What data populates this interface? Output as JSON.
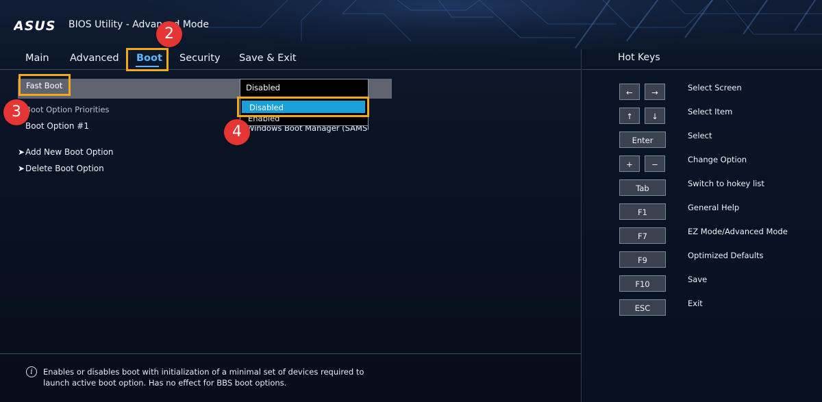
{
  "header": {
    "brand": "ASUS",
    "title": "BIOS Utility - Advanced Mode"
  },
  "tabs": [
    {
      "label": "Main"
    },
    {
      "label": "Advanced"
    },
    {
      "label": "Boot",
      "active": true
    },
    {
      "label": "Security"
    },
    {
      "label": "Save & Exit"
    }
  ],
  "settings": {
    "fast_boot": {
      "label": "Fast Boot",
      "value": "Disabled"
    },
    "priorities_label": "Boot Option Priorities",
    "boot_option_1": {
      "label": "Boot Option #1",
      "value": "Windows Boot Manager (SAMSUNG"
    },
    "add_boot": "Add New Boot Option",
    "delete_boot": "Delete Boot Option"
  },
  "dropdown": {
    "options": [
      "Disabled",
      "Enabled"
    ],
    "highlighted_index": 0
  },
  "annotations": [
    "2",
    "3",
    "4"
  ],
  "hotkeys": {
    "title": "Hot Keys",
    "items": [
      {
        "keys": [
          "←",
          "→"
        ],
        "desc": "Select Screen"
      },
      {
        "keys": [
          "↑",
          "↓"
        ],
        "desc": "Select Item"
      },
      {
        "keys": [
          "Enter"
        ],
        "desc": "Select"
      },
      {
        "keys": [
          "+",
          "−"
        ],
        "desc": "Change Option"
      },
      {
        "keys": [
          "Tab"
        ],
        "desc": "Switch to hokey list"
      },
      {
        "keys": [
          "F1"
        ],
        "desc": "General Help"
      },
      {
        "keys": [
          "F7"
        ],
        "desc": "EZ Mode/Advanced Mode"
      },
      {
        "keys": [
          "F9"
        ],
        "desc": "Optimized Defaults"
      },
      {
        "keys": [
          "F10"
        ],
        "desc": "Save"
      },
      {
        "keys": [
          "ESC"
        ],
        "desc": "Exit"
      }
    ]
  },
  "info": {
    "icon": "info-icon",
    "line1": "Enables or disables boot with initialization of a minimal set of devices required to",
    "line2": "launch active boot option. Has no effect for BBS boot options."
  },
  "colors": {
    "accent": "#5fb6ff",
    "highlight": "#f4a81c",
    "badge": "#e53535",
    "dropdown_selection": "#1aa0d8"
  }
}
